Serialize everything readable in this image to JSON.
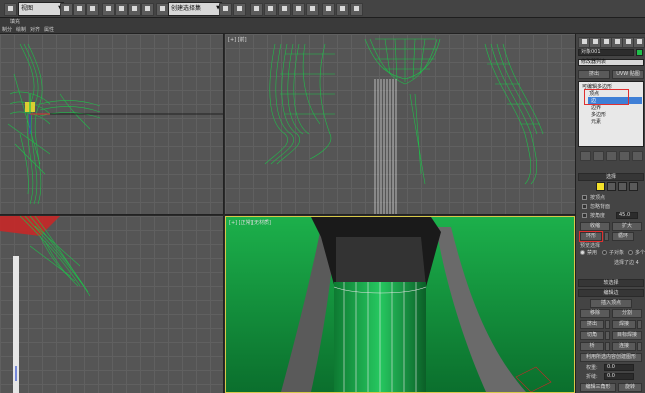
{
  "toolbar": {
    "view_dropdown": "视图",
    "selection_set_dropdown": "创建选择集"
  },
  "ribbon": {
    "title": "填充",
    "menu": [
      "制分",
      "绘制",
      "对齐",
      "属性"
    ]
  },
  "viewports": {
    "top_left_label": "",
    "top_right_label": "[+] [前]",
    "bottom_right_label": "[+] [正常]",
    "bottom_right_label2": "[无材质]"
  },
  "panel": {
    "object_name": "对象001",
    "modifier_list": "修改器列表",
    "stack_header_left": "挤出",
    "stack_header_right": "UVW 贴图",
    "stack_items": [
      "可编辑多边形",
      "顶点",
      "边",
      "边界",
      "多边形",
      "元素"
    ],
    "selection_header": "选择",
    "selection_options": [
      "按顶点",
      "忽略背面",
      "按角度"
    ],
    "angle_value": "45.0",
    "shrink_label": "收缩",
    "grow_label": "扩大",
    "ring_label": "环形",
    "loop_label": "循环",
    "preview_label": "预览选择",
    "preview_options": [
      "禁用",
      "子对象",
      "多个"
    ],
    "selected_count": "选择了边 4",
    "soft_selection_header": "软选择",
    "edit_edges_header": "编辑边",
    "insert_vertex": "插入顶点",
    "remove_label": "移除",
    "split_label": "分割",
    "extrude_label": "挤出",
    "weld_label": "焊接",
    "chamfer_label": "切角",
    "target_weld_label": "目标焊接",
    "bridge_label": "桥",
    "connect_label": "连接",
    "create_shape_label": "利用所选内容创建图形",
    "weight_label": "权重:",
    "weight_value": "0.0",
    "crease_label": "折缝:",
    "crease_value": "0.0",
    "edit_tri_label": "编辑三角形",
    "rotate_label": "旋转"
  },
  "colors": {
    "wire_green": "#1fbf4a",
    "viewport_bg": "#555555",
    "shaded_green": "#0f8f3a",
    "highlight_red": "#e03030",
    "select_yellow": "#f4e12a"
  }
}
